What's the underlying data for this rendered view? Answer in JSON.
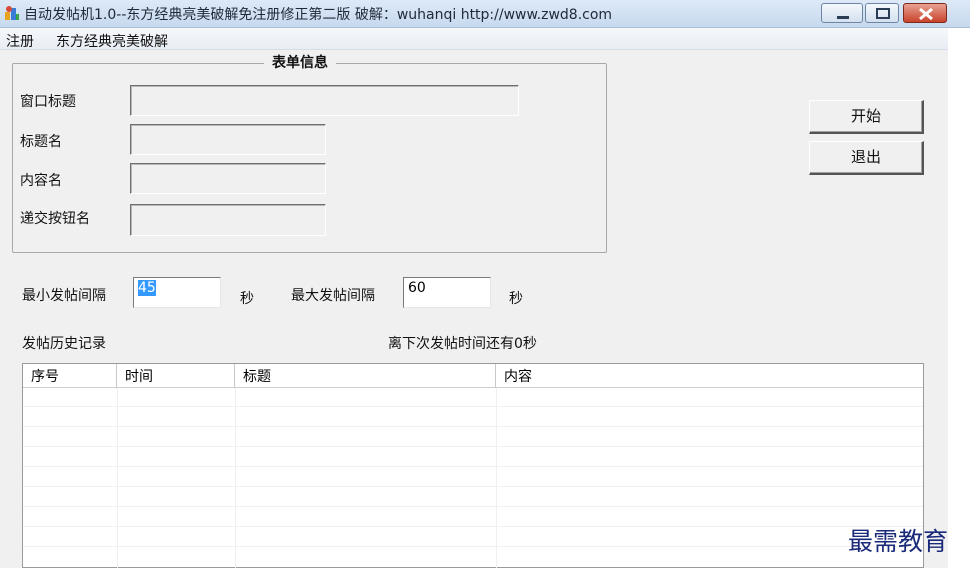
{
  "window": {
    "title": "自动发帖机1.0--东方经典亮美破解免注册修正第二版    破解：wuhanqi   http://www.zwd8.com"
  },
  "menu": [
    "注册",
    "东方经典亮美破解"
  ],
  "group": {
    "title": "表单信息",
    "fields": [
      {
        "label": "窗口标题",
        "value": ""
      },
      {
        "label": "标题名",
        "value": ""
      },
      {
        "label": "内容名",
        "value": ""
      },
      {
        "label": "递交按钮名",
        "value": ""
      }
    ]
  },
  "buttons": {
    "start": "开始",
    "exit": "退出"
  },
  "interval": {
    "min_label": "最小发帖间隔",
    "min_value": "45",
    "min_unit": "秒",
    "max_label": "最大发帖间隔",
    "max_value": "60",
    "max_unit": "秒"
  },
  "history": {
    "title": "发帖历史记录",
    "countdown": "离下次发帖时间还有0秒",
    "columns": [
      "序号",
      "时间",
      "标题",
      "内容"
    ]
  },
  "watermark": "最需教育"
}
